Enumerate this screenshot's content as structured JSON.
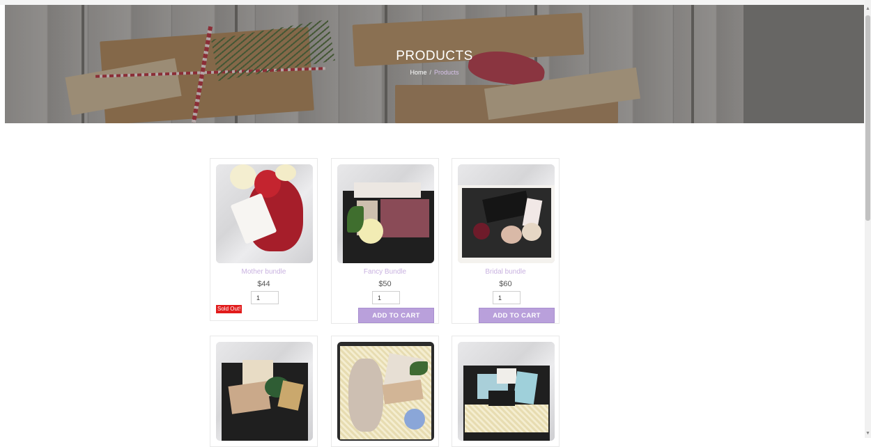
{
  "hero": {
    "title": "PRODUCTS",
    "breadcrumb": {
      "home": "Home",
      "separator": "/",
      "current": "Products"
    }
  },
  "products": [
    {
      "name": "Mother bundle",
      "price": "$44",
      "qty": "1",
      "status": "Sold Out!"
    },
    {
      "name": "Fancy Bundle",
      "price": "$50",
      "qty": "1",
      "button": "ADD TO CART"
    },
    {
      "name": "Bridal bundle",
      "price": "$60",
      "qty": "1",
      "button": "ADD TO CART"
    },
    {
      "name": "",
      "price": "",
      "qty": ""
    },
    {
      "name": "",
      "price": "",
      "qty": ""
    },
    {
      "name": "",
      "price": "",
      "qty": ""
    }
  ],
  "colors": {
    "accent": "#b9a0db",
    "product_name": "#c9b2e0",
    "sold_out": "#e11b1b",
    "hero_overlay": "#555555"
  }
}
